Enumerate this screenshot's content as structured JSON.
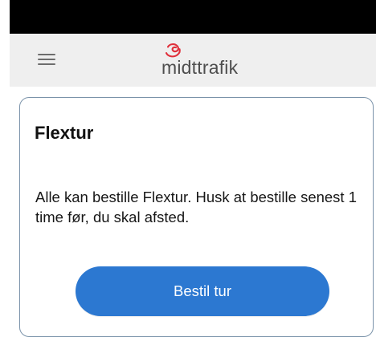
{
  "colors": {
    "status_bar": "#000000",
    "header_background": "#efefef",
    "menu_icon": "#6d6d6d",
    "brand_accent": "#e0303b",
    "brand_text": "#4e4e4e",
    "card_border": "#7b93aa",
    "primary_button": "#2c78d1",
    "primary_button_text": "#ffffff"
  },
  "header": {
    "menu_icon": "hamburger-menu-icon",
    "brand_icon": "midttrafik-logo-icon",
    "brand_name": "midttrafik"
  },
  "main": {
    "card": {
      "title": "Flextur",
      "description": "Alle kan bestille Flextur. Husk at bestille senest 1 time før, du skal afsted.",
      "button_label": "Bestil tur"
    }
  }
}
